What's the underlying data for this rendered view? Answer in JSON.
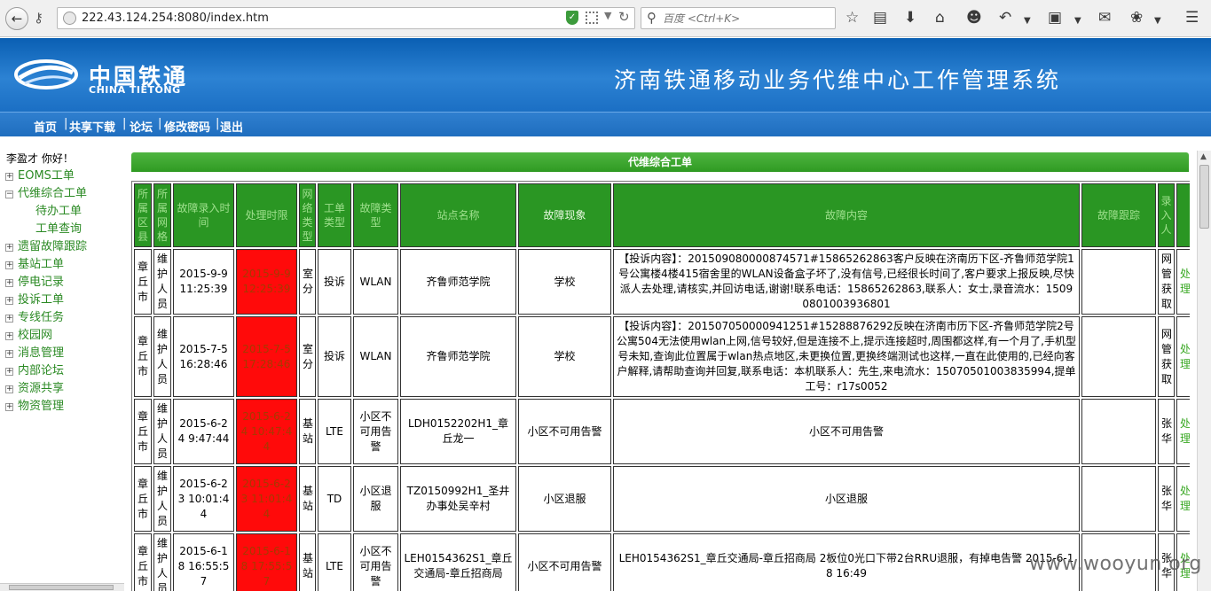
{
  "browser": {
    "url": "222.43.124.254:8080/index.htm",
    "search_placeholder": "百度 <Ctrl+K>",
    "icons": [
      "back-arrow-icon",
      "key-icon",
      "globe-icon",
      "shield-icon",
      "qr-icon",
      "reload-icon",
      "search-icon",
      "star-icon",
      "reader-icon",
      "download-icon",
      "home-icon",
      "emoji-icon",
      "undo-icon",
      "crop-icon",
      "chat-icon",
      "bug-icon",
      "menu-icon"
    ]
  },
  "header": {
    "logo_cn": "中国铁通",
    "logo_en": "CHINA TIETONG",
    "system_title": "济南铁通移动业务代维中心工作管理系统"
  },
  "menu": [
    "首页",
    "共享下载",
    "论坛",
    "修改密码",
    "退出"
  ],
  "sidebar": {
    "greeting": "李盈才  你好！",
    "items": [
      {
        "label": "EOMS工单",
        "expanded": false
      },
      {
        "label": "代维综合工单",
        "expanded": true,
        "children": [
          "待办工单",
          "工单查询"
        ]
      },
      {
        "label": "遗留故障跟踪",
        "expanded": false
      },
      {
        "label": "基站工单",
        "expanded": false
      },
      {
        "label": "停电记录",
        "expanded": false
      },
      {
        "label": "投诉工单",
        "expanded": false
      },
      {
        "label": "专线任务",
        "expanded": false
      },
      {
        "label": "校园网",
        "expanded": false
      },
      {
        "label": "消息管理",
        "expanded": false
      },
      {
        "label": "内部论坛",
        "expanded": false
      },
      {
        "label": "资源共享",
        "expanded": false
      },
      {
        "label": "物资管理",
        "expanded": false
      }
    ]
  },
  "panel": {
    "title": "代维综合工单",
    "columns": [
      "所属区县",
      "所属网格",
      "故障录入时间",
      "处理时限",
      "网络类型",
      "工单类型",
      "故障类型",
      "站点名称",
      "故障现象",
      "故障内容",
      "故障跟踪",
      "录入人",
      ""
    ],
    "rows": [
      {
        "district": "章丘市",
        "grid": "维护人员",
        "entry_time": "2015-9-9 11:25:39",
        "deadline": "2015-9-9 12:25:39",
        "network": "室分",
        "order_type": "投诉",
        "fault_type": "WLAN",
        "site": "齐鲁师范学院",
        "symptom": "学校",
        "content": "【投诉内容】：201509080000874571#15865262863客户反映在济南历下区-齐鲁师范学院1号公寓楼4楼415宿舍里的WLAN设备盒子坏了,没有信号,已经很长时间了,客户要求上报反映,尽快派人去处理,请核实,并回访电话,谢谢!联系电话：15865262863,联系人：女士,录音流水：15090801003936801",
        "tracking": "",
        "entered_by": "网管获取",
        "action": "处理"
      },
      {
        "district": "章丘市",
        "grid": "维护人员",
        "entry_time": "2015-7-5 16:28:46",
        "deadline": "2015-7-5 17:28:46",
        "network": "室分",
        "order_type": "投诉",
        "fault_type": "WLAN",
        "site": "齐鲁师范学院",
        "symptom": "学校",
        "content": "【投诉内容】：201507050000941251#15288876292反映在济南市历下区-齐鲁师范学院2号公寓504无法使用wlan上网,信号较好,但是连接不上,提示连接超时,周围都这样,有一个月了,手机型号未知,查询此位置属于wlan热点地区,未更换位置,更换终端测试也这样,一直在此使用的,已经向客户解释,请帮助查询并回复,联系电话：本机联系人：先生,来电流水：15070501003835994,提单工号：r17s0052",
        "tracking": "",
        "entered_by": "网管获取",
        "action": "处理"
      },
      {
        "district": "章丘市",
        "grid": "维护人员",
        "entry_time": "2015-6-24 9:47:44",
        "deadline": "2015-6-24 10:47:44",
        "network": "基站",
        "order_type": "LTE",
        "fault_type": "小区不可用告警",
        "site": "LDH0152202H1_章丘龙一",
        "symptom": "小区不可用告警",
        "content": "小区不可用告警",
        "tracking": "",
        "entered_by": "张华",
        "action": "处理"
      },
      {
        "district": "章丘市",
        "grid": "维护人员",
        "entry_time": "2015-6-23 10:01:44",
        "deadline": "2015-6-23 11:01:44",
        "network": "基站",
        "order_type": "TD",
        "fault_type": "小区退服",
        "site": "TZ0150992H1_圣井办事处吴辛村",
        "symptom": "小区退服",
        "content": "小区退服",
        "tracking": "",
        "entered_by": "张华",
        "action": "处理"
      },
      {
        "district": "章丘市",
        "grid": "维护人员",
        "entry_time": "2015-6-18 16:55:57",
        "deadline": "2015-6-18 17:55:57",
        "network": "基站",
        "order_type": "LTE",
        "fault_type": "小区不可用告警",
        "site": "LEH0154362S1_章丘交通局-章丘招商局",
        "symptom": "小区不可用告警",
        "content": "LEH0154362S1_章丘交通局-章丘招商局 2板位0光口下带2台RRU退服，有掉电告警 2015-6-18 16:49",
        "tracking": "",
        "entered_by": "张华",
        "action": "处理"
      }
    ]
  },
  "watermark": "www.wooyun.org",
  "colors": {
    "banner_blue": "#1b6fc4",
    "panel_green": "#2f9a22",
    "overdue_red": "#ff0a0a",
    "link_green": "#2b8a24"
  }
}
